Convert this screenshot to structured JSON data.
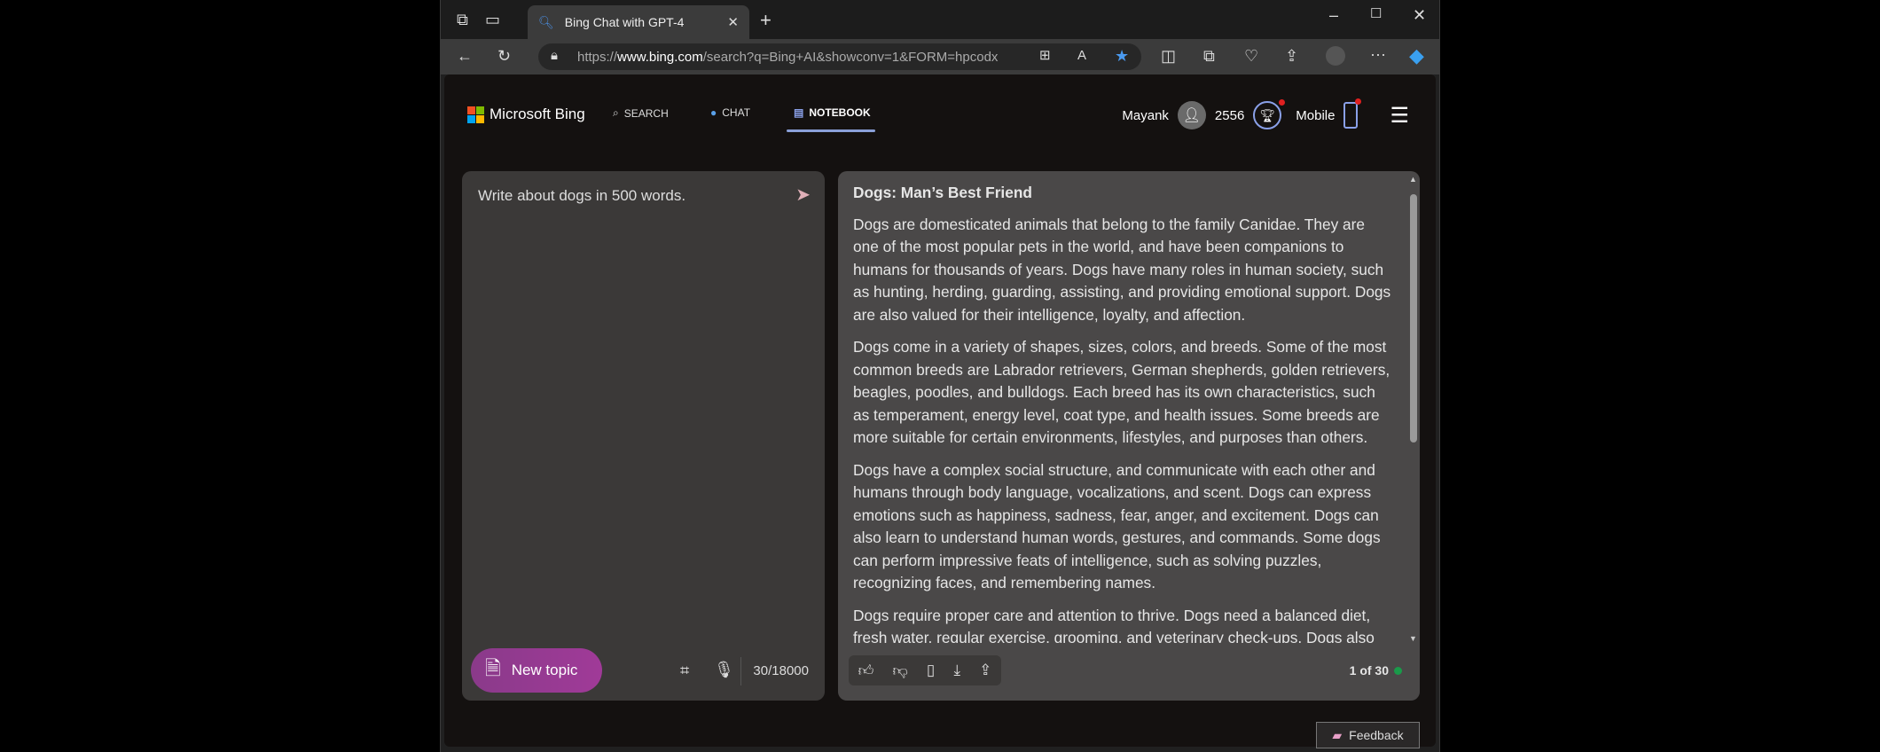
{
  "browser": {
    "tab_title": "Bing Chat with GPT-4",
    "url_prefix": "https://",
    "url_domain": "www.bing.com",
    "url_path": "/search?q=Bing+AI&showconv=1&FORM=hpcodx"
  },
  "header": {
    "logo": "Microsoft Bing",
    "nav": [
      {
        "label": "SEARCH"
      },
      {
        "label": "CHAT"
      },
      {
        "label": "NOTEBOOK"
      }
    ],
    "user": "Mayank",
    "points": "2556",
    "mobile": "Mobile"
  },
  "composer": {
    "prompt": "Write about dogs in 500 words.",
    "new_topic": "New topic",
    "char_count": "30/18000"
  },
  "response": {
    "title": "Dogs: Man’s Best Friend",
    "paragraphs": [
      "Dogs are domesticated animals that belong to the family Canidae. They are one of the most popular pets in the world, and have been companions to humans for thousands of years. Dogs have many roles in human society, such as hunting, herding, guarding, assisting, and providing emotional support. Dogs are also valued for their intelligence, loyalty, and affection.",
      "Dogs come in a variety of shapes, sizes, colors, and breeds. Some of the most common breeds are Labrador retrievers, German shepherds, golden retrievers, beagles, poodles, and bulldogs. Each breed has its own characteristics, such as temperament, energy level, coat type, and health issues. Some breeds are more suitable for certain environments, lifestyles, and purposes than others.",
      "Dogs have a complex social structure, and communicate with each other and humans through body language, vocalizations, and scent. Dogs can express emotions such as happiness, sadness, fear, anger, and excitement. Dogs can also learn to understand human words, gestures, and commands. Some dogs can perform impressive feats of intelligence, such as solving puzzles, recognizing faces, and remembering names.",
      "Dogs require proper care and attention to thrive. Dogs need a balanced diet, fresh water, regular exercise, grooming, and veterinary check-ups. Dogs also"
    ],
    "page_indicator": "1 of 30"
  },
  "feedback": "Feedback"
}
